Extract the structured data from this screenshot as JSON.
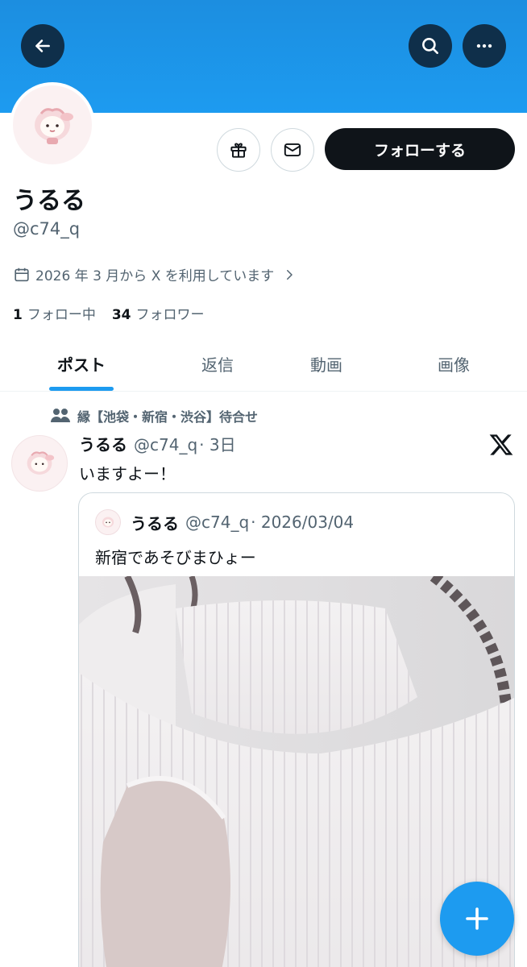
{
  "colors": {
    "accent": "#1d9bf0",
    "text": "#0f1419",
    "muted": "#536471",
    "border": "#cfd9de",
    "header_button": "#0f2f4a"
  },
  "header": {
    "back_icon": "back-arrow-icon",
    "search_icon": "search-icon",
    "more_icon": "more-icon"
  },
  "profile": {
    "name": "うるる",
    "handle": "@c74_q",
    "joined": "2026 年 3 月から X を利用しています",
    "following_count": "1",
    "following_label": "フォロー中",
    "followers_count": "34",
    "followers_label": "フォロワー",
    "follow_button": "フォローする",
    "gift_icon": "gift-icon",
    "message_icon": "mail-icon"
  },
  "tabs": [
    {
      "label": "ポスト",
      "active": true
    },
    {
      "label": "返信",
      "active": false
    },
    {
      "label": "動画",
      "active": false
    },
    {
      "label": "画像",
      "active": false
    }
  ],
  "post": {
    "context": "縁【池袋・新宿・渋谷】待合せ",
    "name": "うるる",
    "handle": "@c74_q",
    "time": "· 3日",
    "text": "いますよー！",
    "quote": {
      "name": "うるる",
      "handle": "@c74_q",
      "date": "· 2026/03/04",
      "text": "新宿であそびまひょー"
    }
  },
  "fab": {
    "icon": "plus-icon"
  }
}
